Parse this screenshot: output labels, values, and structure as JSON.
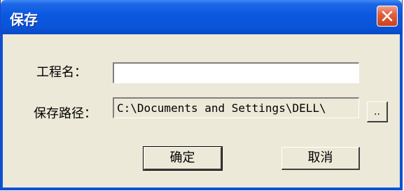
{
  "window": {
    "title": "保存"
  },
  "form": {
    "project_name_label": "工程名：",
    "project_name_value": "",
    "save_path_label": "保存路径：",
    "save_path_value": "C:\\Documents and Settings\\DELL\\",
    "browse_label": ".."
  },
  "buttons": {
    "ok_label": "确定",
    "cancel_label": "取消"
  },
  "icons": {
    "close": "close-x-icon"
  },
  "colors": {
    "titlebar": "#0a54d8",
    "client_bg": "#ece9d8",
    "close_button": "#e1603e"
  }
}
